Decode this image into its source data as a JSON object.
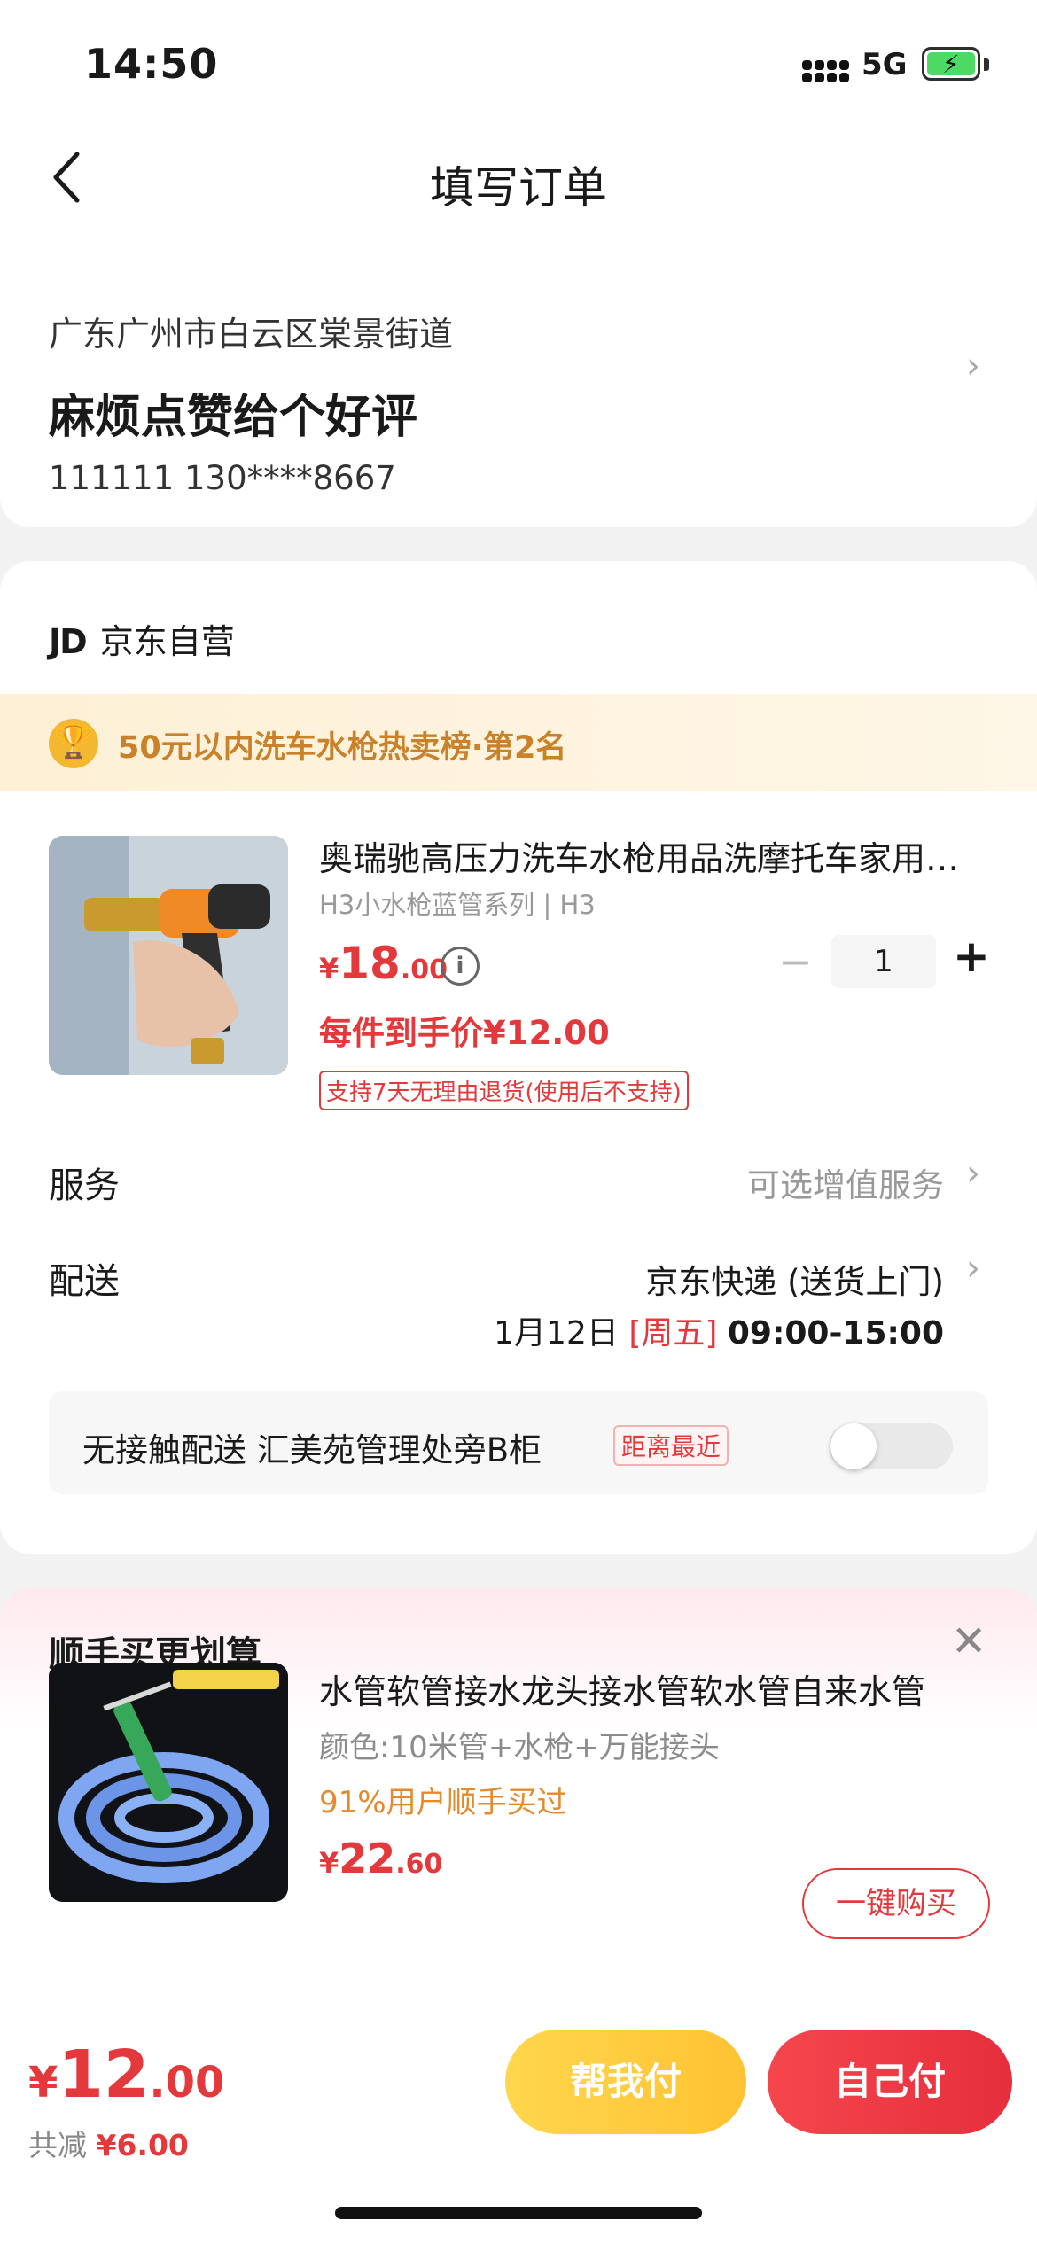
{
  "status_bar": {
    "time": "14:50",
    "network": "5G"
  },
  "header": {
    "title": "填写订单"
  },
  "address": {
    "line": "广东广州市白云区棠景街道",
    "name": "麻烦点赞给个好评",
    "contact": "111111  130****8667"
  },
  "shop": {
    "logo": "JD",
    "name": "京东自营"
  },
  "ranking": {
    "text": "50元以内洗车水枪热卖榜·第2名"
  },
  "product": {
    "title": "奥瑞驰高压力洗车水枪用品洗摩托车家用高压力洗车水枪",
    "spec": "H3小水枪蓝管系列 | H3",
    "price_symbol": "¥",
    "price_int": "18",
    "price_dec": ".00",
    "quantity": "1",
    "unit_price": "每件到手价¥12.00",
    "return_policy": "支持7天无理由退货(使用后不支持)"
  },
  "service": {
    "label": "服务",
    "value": "可选增值服务"
  },
  "delivery": {
    "label": "配送",
    "method": "京东快递 (送货上门)",
    "date": "1月12日",
    "weekday": "[周五]",
    "time": "09:00-15:00"
  },
  "contactless": {
    "text": "无接触配送  汇美苑管理处旁B柜",
    "tag": "距离最近",
    "enabled": false
  },
  "recommend": {
    "title": "顺手买更划算",
    "name": "水管软管接水龙头接水管软水管自来水管",
    "color": "颜色:10米管+水枪+万能接头",
    "stat": "91%用户顺手买过",
    "price_symbol": "¥",
    "price_int": "22",
    "price_dec": ".60",
    "buy_label": "一键购买"
  },
  "footer": {
    "price_symbol": "¥",
    "total_int": "12",
    "total_dec": ".00",
    "saved_label": "共减",
    "saved_value": "¥6.00",
    "help_pay": "帮我付",
    "self_pay": "自己付"
  },
  "colors": {
    "accent": "#e4393c",
    "gold": "#ffc233",
    "rank_text": "#c9822a"
  },
  "icons": [
    "back-arrow-icon",
    "chevron-right-icon",
    "trophy-icon",
    "info-icon",
    "close-icon",
    "battery-icon",
    "signal-icon"
  ]
}
